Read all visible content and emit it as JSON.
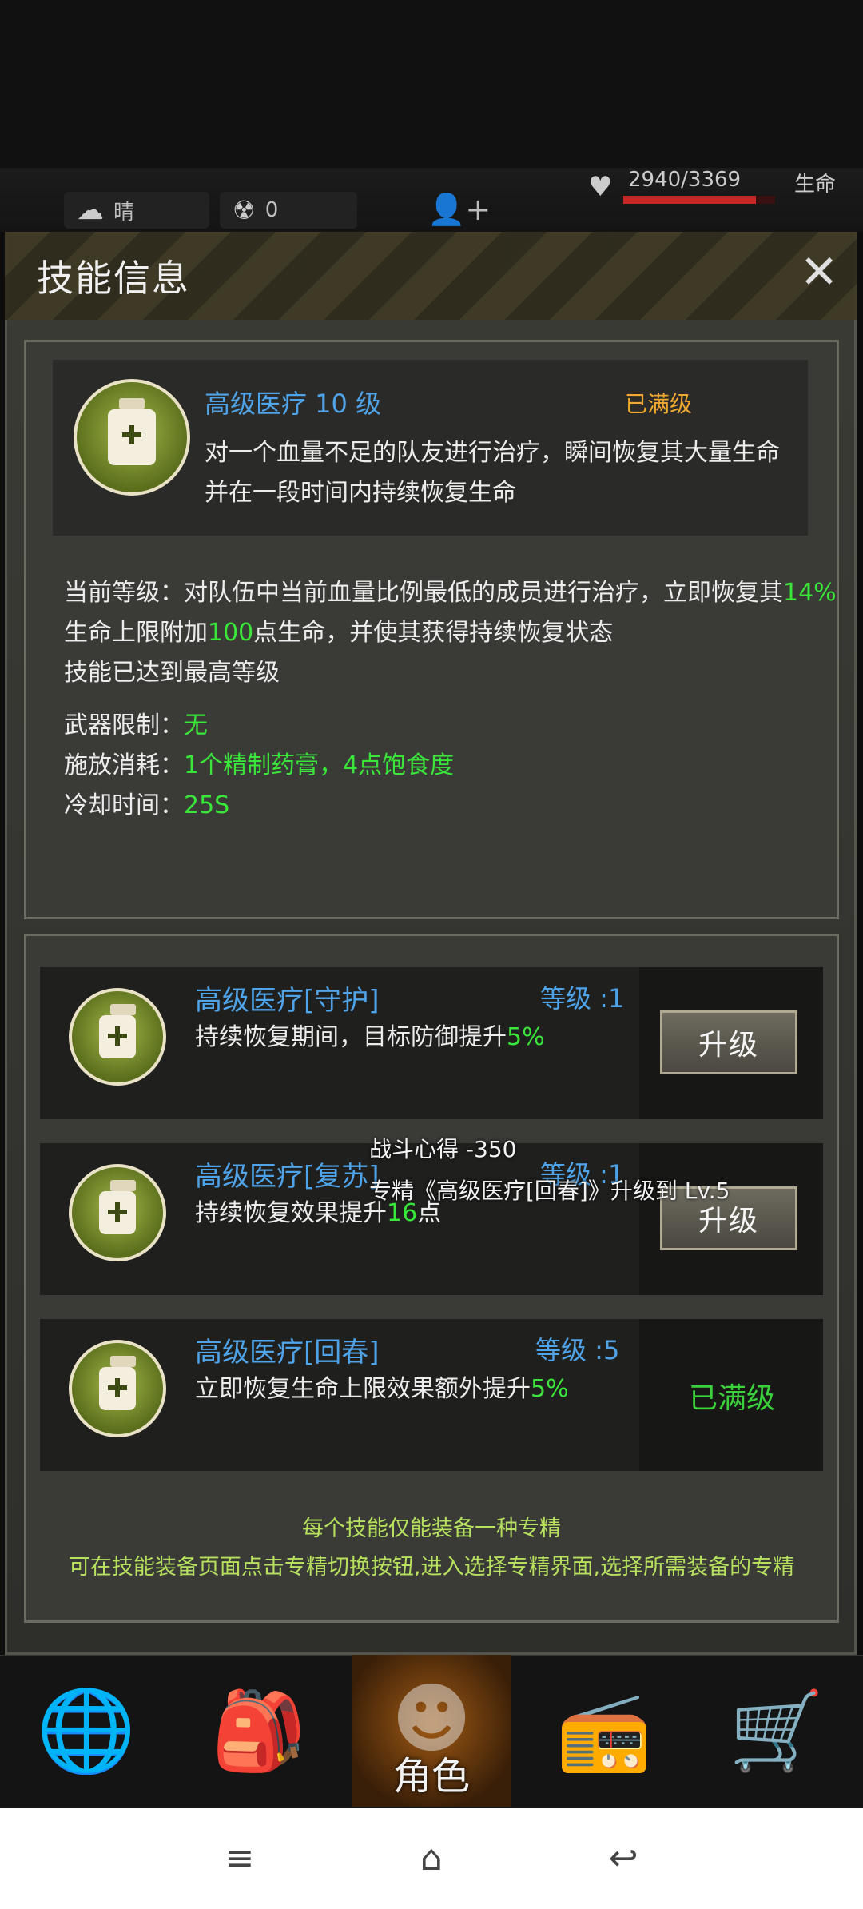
{
  "hud": {
    "weather": "晴",
    "radiation": "0",
    "hp": "2940/3369",
    "hp_fraction": 0.873,
    "hp_label": "生命"
  },
  "dialog": {
    "title": "技能信息",
    "close_symbol": "✕"
  },
  "skill": {
    "name": "高级医疗 10 级",
    "status": "已满级",
    "description": "对一个血量不足的队友进行治疗，瞬间恢复其大量生命并在一段时间内持续恢复生命",
    "current_level_prefix": "当前等级：对队伍中当前血量比例最低的成员进行治疗，立即恢复其",
    "current_level_pct": "14%",
    "current_level_line2_prefix": "生命上限附加",
    "current_level_points": "100",
    "current_level_line2_suffix": "点生命，并使其获得持续恢复状态",
    "max_note": "技能已达到最高等级",
    "weapon_label": "武器限制：",
    "weapon_value": "无",
    "cost_label": "施放消耗：",
    "cost_value": "1个精制药膏，4点饱食度",
    "cooldown_label": "冷却时间：",
    "cooldown_value": "25S"
  },
  "specs": [
    {
      "name": "高级医疗[守护]",
      "level": "等级 :1",
      "desc": "持续恢复期间，目标防御提升",
      "value": "5%",
      "action": "升级"
    },
    {
      "name": "高级医疗[复苏]",
      "level": "等级 :1",
      "desc": "持续恢复效果提升",
      "value": "16",
      "value_suffix": "点",
      "action": "升级"
    },
    {
      "name": "高级医疗[回春]",
      "level": "等级 :5",
      "desc": "立即恢复生命上限效果额外提升",
      "value": "5%",
      "action": "已满级"
    }
  ],
  "toast": {
    "line1": "战斗心得 -350",
    "line2": "专精《高级医疗[回春]》升级到 Lv.5"
  },
  "footer": {
    "note1": "每个技能仅能装备一种专精",
    "note2": "可在技能装备页面点击专精切换按钮,进入选择专精界面,选择所需装备的专精"
  },
  "nav": {
    "active_label": "角色"
  },
  "icons": [
    "cloud-icon",
    "radiation-icon",
    "person-icon",
    "heart-icon",
    "close-icon",
    "globe-icon",
    "backpack-icon",
    "head-icon",
    "radio-icon",
    "cart-icon",
    "menu-icon",
    "home-icon",
    "back-icon"
  ]
}
